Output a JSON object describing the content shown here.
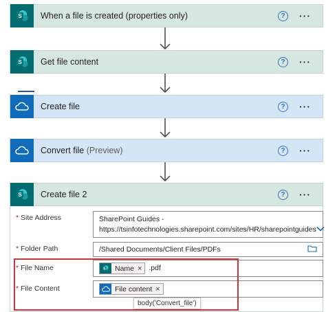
{
  "steps": [
    {
      "title": "When a file is created (properties only)",
      "connector": "sharepoint-icon"
    },
    {
      "title": "Get file content",
      "connector": "sharepoint-icon"
    },
    {
      "title": "Create file",
      "connector": "onedrive-icon"
    },
    {
      "title": "Convert file",
      "preview": "(Preview)",
      "connector": "onedrive-icon"
    },
    {
      "title": "Create file 2",
      "connector": "sharepoint-icon"
    }
  ],
  "help_symbol": "?",
  "more_symbol": "···",
  "form": {
    "site_address": {
      "label": "Site Address",
      "value_line1": "SharePoint Guides -",
      "value_line2": "https://tsinfotechnologies.sharepoint.com/sites/HR/sharepointguides"
    },
    "folder_path": {
      "label": "Folder Path",
      "value": "/Shared Documents/Client Files/PDFs"
    },
    "file_name": {
      "label": "File Name",
      "token": "Name",
      "suffix": ".pdf"
    },
    "file_content": {
      "label": "File Content",
      "token": "File content"
    },
    "required_mark": "*",
    "token_remove": "×"
  },
  "tooltip": "body('Convert_file')",
  "colors": {
    "sharepoint": "#036c70",
    "onedrive": "#0f6cbd",
    "highlight": "#d13438"
  }
}
